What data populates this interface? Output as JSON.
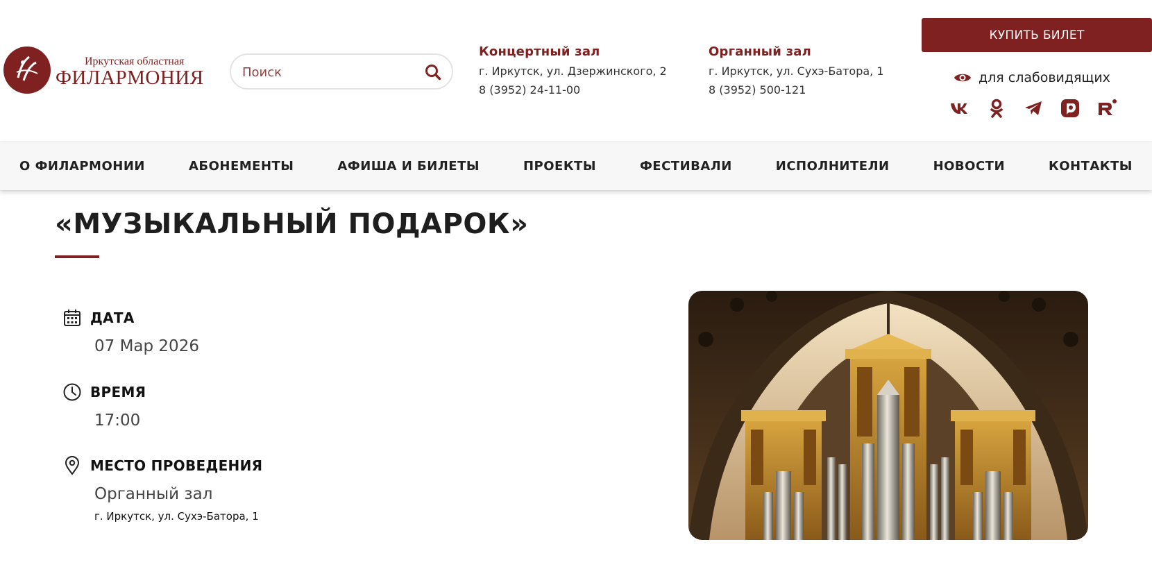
{
  "header": {
    "logo": {
      "subtitle": "Иркутская областная",
      "name": "ФИЛАРМОНИЯ"
    },
    "search": {
      "placeholder": "Поиск"
    },
    "venues": [
      {
        "name": "Концертный зал",
        "address": "г. Иркутск, ул. Дзержинского, 2",
        "phone": "8 (3952) 24-11-00"
      },
      {
        "name": "Органный зал",
        "address": "г. Иркутск, ул. Сухэ-Батора, 1",
        "phone": "8 (3952) 500-121"
      }
    ],
    "buy_label": "КУПИТЬ БИЛЕТ",
    "impaired_label": "для слабовидящих",
    "socials": [
      "vk-icon",
      "odnoklassniki-icon",
      "telegram-icon",
      "dzen-icon",
      "rutube-icon"
    ]
  },
  "nav": {
    "items": [
      "О ФИЛАРМОНИИ",
      "АБОНЕМЕНТЫ",
      "АФИША И БИЛЕТЫ",
      "ПРОЕКТЫ",
      "ФЕСТИВАЛИ",
      "ИСПОЛНИТЕЛИ",
      "НОВОСТИ",
      "КОНТАКТЫ"
    ]
  },
  "event": {
    "title": "«МУЗЫКАЛЬНЫЙ ПОДАРОК»",
    "date_label": "ДАТА",
    "date_value": "07 Мар 2026",
    "time_label": "ВРЕМЯ",
    "time_value": "17:00",
    "place_label": "МЕСТО ПРОВЕДЕНИЯ",
    "place_value": "Органный зал",
    "place_address": "г. Иркутск, ул. Сухэ-Батора, 1"
  },
  "colors": {
    "accent": "#7f2121",
    "nav_bg": "#f7f7f7",
    "text": "#222222"
  }
}
